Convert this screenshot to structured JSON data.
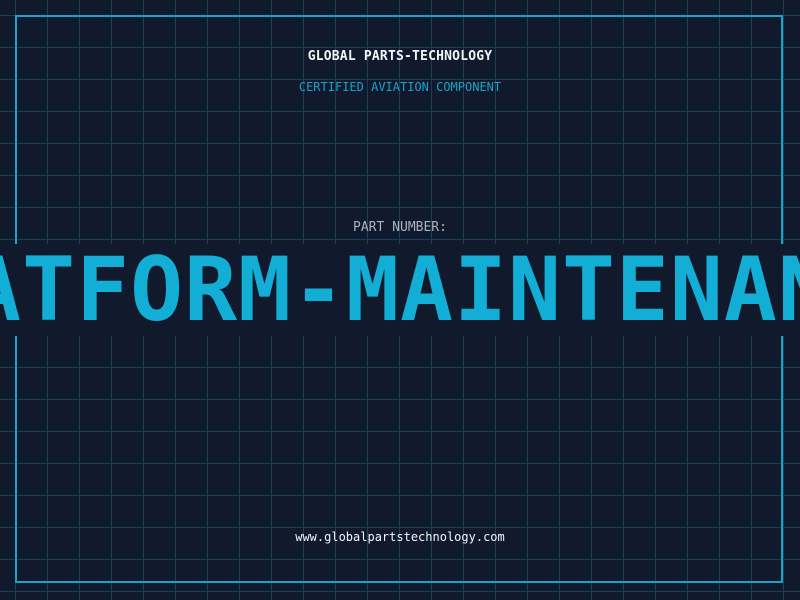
{
  "header": {
    "company": "GLOBAL PARTS-TECHNOLOGY",
    "subtitle": "CERTIFIED AVIATION COMPONENT"
  },
  "part": {
    "label": "PART NUMBER:",
    "number": "PLATFORM-MAINTENANCE"
  },
  "footer": {
    "website": "www.globalpartstechnology.com"
  },
  "colors": {
    "background": "#101a2c",
    "grid": "#1d3f55",
    "accent": "#1aa3c8",
    "text": "#f2f5f8"
  }
}
